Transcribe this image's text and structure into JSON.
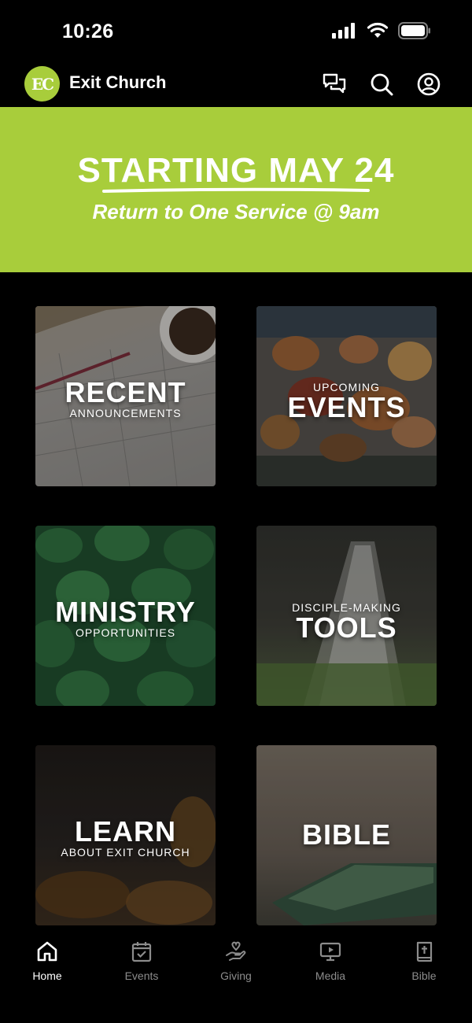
{
  "status_bar": {
    "time": "10:26",
    "icons": [
      "signal-icon",
      "wifi-icon",
      "battery-icon"
    ]
  },
  "header": {
    "logo_text": "EC",
    "title": "Exit Church",
    "icons": [
      "chat-icon",
      "search-icon",
      "profile-icon"
    ]
  },
  "banner": {
    "title": "STARTING MAY 24",
    "subtitle": "Return to One Service @ 9am",
    "color": "#a8cd3b"
  },
  "tiles": [
    {
      "big": "RECENT",
      "small": "ANNOUNCEMENTS"
    },
    {
      "small": "UPCOMING",
      "big": "EVENTS"
    },
    {
      "big": "MINISTRY",
      "small": "OPPORTUNITIES"
    },
    {
      "small": "DISCIPLE-MAKING",
      "big": "TOOLS"
    },
    {
      "big": "LEARN",
      "small": "ABOUT EXIT CHURCH"
    },
    {
      "big": "BIBLE"
    }
  ],
  "tab_bar": {
    "items": [
      {
        "label": "Home",
        "icon": "home-icon",
        "active": true
      },
      {
        "label": "Events",
        "icon": "calendar-icon",
        "active": false
      },
      {
        "label": "Giving",
        "icon": "giving-hand-icon",
        "active": false
      },
      {
        "label": "Media",
        "icon": "media-icon",
        "active": false
      },
      {
        "label": "Bible",
        "icon": "bible-icon",
        "active": false
      }
    ],
    "active_color": "#ffffff",
    "inactive_color": "#8c8c8c"
  }
}
